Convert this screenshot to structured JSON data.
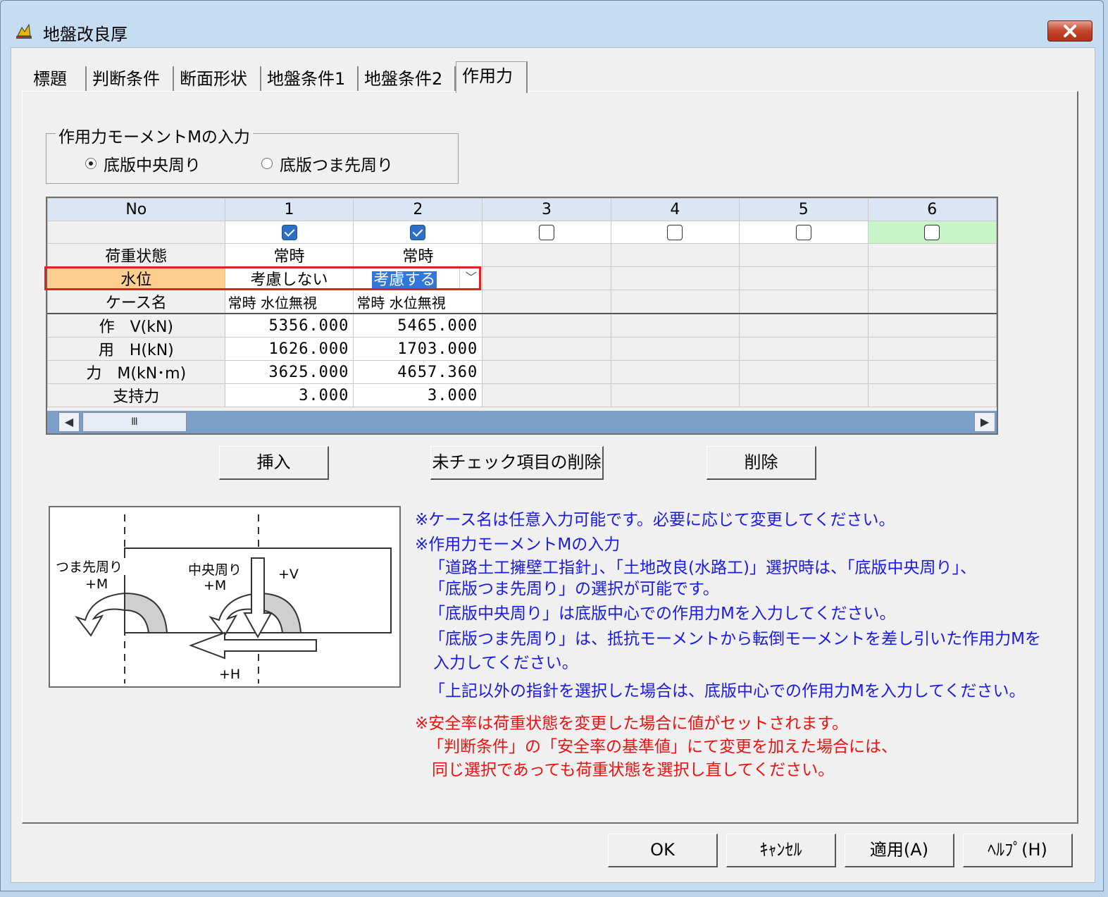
{
  "window": {
    "title": "地盤改良厚",
    "close_label": "✕"
  },
  "tabs": [
    {
      "label": "標題"
    },
    {
      "label": "判断条件"
    },
    {
      "label": "断面形状"
    },
    {
      "label": "地盤条件1"
    },
    {
      "label": "地盤条件2"
    },
    {
      "label": "作用力",
      "active": true
    }
  ],
  "moment_group": {
    "title": "作用力モーメントMの入力",
    "options": [
      {
        "label": "底版中央周り",
        "selected": true
      },
      {
        "label": "底版つま先周り",
        "selected": false
      }
    ]
  },
  "grid": {
    "header_no": "No",
    "columns": [
      "1",
      "2",
      "3",
      "4",
      "5",
      "6"
    ],
    "checked": [
      true,
      true,
      false,
      false,
      false,
      false
    ],
    "row_labels": {
      "load_state": "荷重状態",
      "water": "水位",
      "case_name": "ケース名",
      "v": "作　V(kN)",
      "h": "用　H(kN)",
      "m": "力　M(kN･m)",
      "support": "支持力"
    },
    "data": [
      {
        "load_state": "常時",
        "water": "考慮しない",
        "case_name": "常時 水位無視",
        "v": "5356.000",
        "h": "1626.000",
        "m": "3625.000",
        "support": "3.000"
      },
      {
        "load_state": "常時",
        "water": "考慮する",
        "case_name": "常時 水位無視",
        "v": "5465.000",
        "h": "1703.000",
        "m": "4657.360",
        "support": "3.000"
      }
    ],
    "scroll_thumb": "Ⅲ"
  },
  "buttons": {
    "insert": "挿入",
    "delete_unchecked": "未チェック項目の削除",
    "delete": "削除"
  },
  "figure": {
    "label_toe": "つま先周り",
    "label_toe_m": "+M",
    "label_center": "中央周り",
    "label_center_m": "+M",
    "label_v": "+V",
    "label_h": "+H"
  },
  "notes": {
    "blue": [
      "※ケース名は任意入力可能です。必要に応じて変更してください。",
      "※作用力モーメントMの入力",
      "「道路土工擁壁工指針」、「土地改良(水路工)」選択時は、「底版中央周り」、",
      "「底版つま先周り」の選択が可能です。",
      "「底版中央周り」は底版中心での作用力Mを入力してください。",
      "「底版つま先周り」は、抵抗モーメントから転倒モーメントを差し引いた作用力Mを",
      "入力してください。",
      "「上記以外の指針を選択した場合は、底版中心での作用力Mを入力してください。"
    ],
    "red": [
      "※安全率は荷重状態を変更した場合に値がセットされます。",
      "「判断条件」の「安全率の基準値」にて変更を加えた場合には、",
      "同じ選択であっても荷重状態を選択し直してください。"
    ]
  },
  "footer": {
    "ok": "OK",
    "cancel": "ｷｬﾝｾﾙ",
    "apply": "適用(A)",
    "help": "ﾍﾙﾌﾟ(H)"
  }
}
